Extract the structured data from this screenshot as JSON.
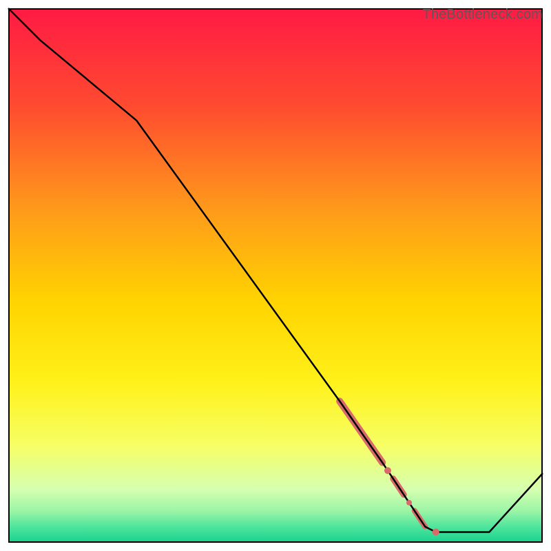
{
  "watermark": "TheBottleneck.com",
  "chart_data": {
    "type": "line",
    "title": "",
    "xlabel": "",
    "ylabel": "",
    "xlim": [
      0,
      100
    ],
    "ylim": [
      0,
      100
    ],
    "grid": false,
    "legend": false,
    "gradient_stops": [
      {
        "pos": 0.0,
        "color": "#ff1a44"
      },
      {
        "pos": 0.18,
        "color": "#ff4a30"
      },
      {
        "pos": 0.38,
        "color": "#ff9b1a"
      },
      {
        "pos": 0.55,
        "color": "#ffd400"
      },
      {
        "pos": 0.7,
        "color": "#fff11a"
      },
      {
        "pos": 0.82,
        "color": "#f6ff66"
      },
      {
        "pos": 0.9,
        "color": "#d6ffb0"
      },
      {
        "pos": 0.94,
        "color": "#9cf5a6"
      },
      {
        "pos": 0.97,
        "color": "#4fe59c"
      },
      {
        "pos": 1.0,
        "color": "#18d18d"
      }
    ],
    "series": [
      {
        "name": "bottleneck-curve",
        "stroke": "#000000",
        "stroke_width": 2.5,
        "x": [
          0.0,
          6.0,
          24.0,
          62.0,
          66.5,
          70.0,
          72.0,
          74.0,
          78.0,
          80.0,
          90.0,
          100.0
        ],
        "y": [
          100.0,
          94.0,
          79.0,
          26.5,
          20.0,
          15.0,
          12.0,
          9.0,
          3.0,
          2.0,
          2.0,
          13.0
        ]
      }
    ],
    "highlight_segments": [
      {
        "name": "thick-segment-upper",
        "stroke": "#d86a6a",
        "stroke_width": 10,
        "linecap": "round",
        "x": [
          62.0,
          70.0
        ],
        "y": [
          26.5,
          15.0
        ]
      },
      {
        "name": "thick-segment-mid",
        "stroke": "#d86a6a",
        "stroke_width": 9,
        "linecap": "round",
        "x": [
          72.0,
          74.0
        ],
        "y": [
          12.0,
          9.0
        ]
      },
      {
        "name": "thick-segment-lower",
        "stroke": "#d86a6a",
        "stroke_width": 8,
        "linecap": "round",
        "x": [
          76.0,
          78.0
        ],
        "y": [
          6.0,
          3.0
        ]
      }
    ],
    "highlight_points": [
      {
        "x": 71.0,
        "y": 13.5,
        "r": 5,
        "color": "#d86a6a"
      },
      {
        "x": 75.0,
        "y": 7.5,
        "r": 4,
        "color": "#d86a6a"
      },
      {
        "x": 80.0,
        "y": 2.0,
        "r": 5,
        "color": "#d86a6a"
      }
    ]
  }
}
